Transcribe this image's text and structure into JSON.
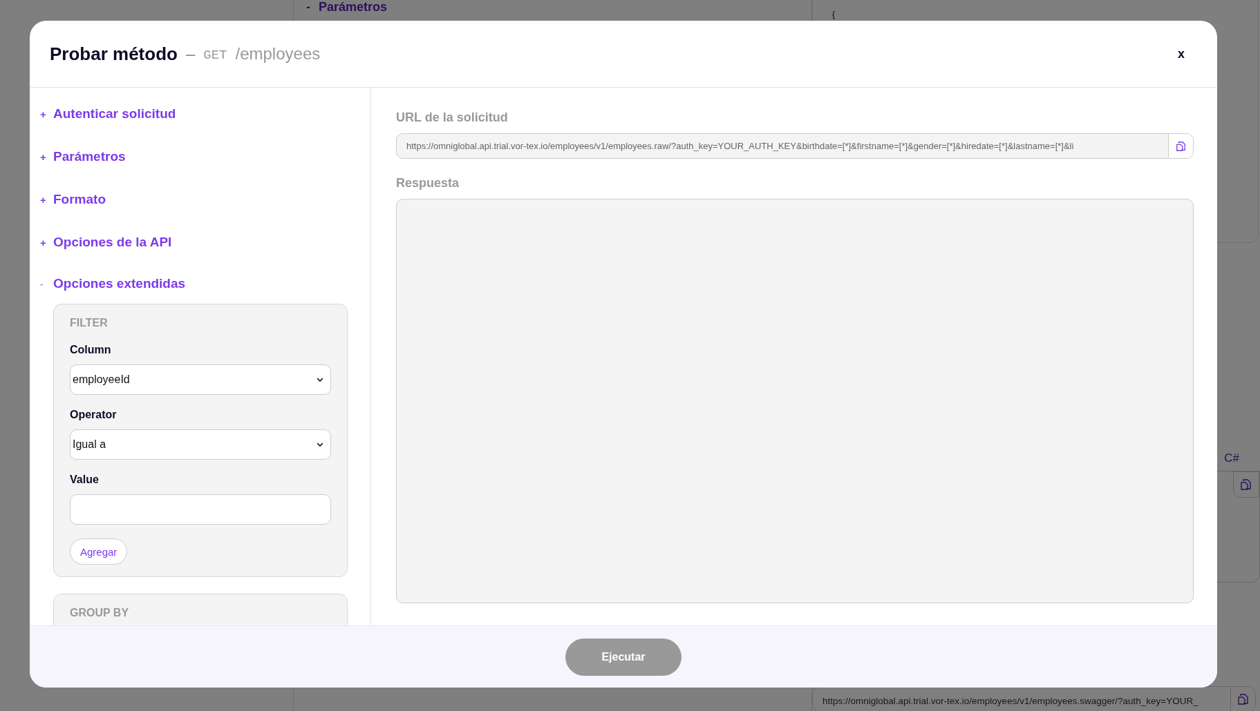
{
  "background": {
    "heading_marker": "-",
    "heading": "Parámetros",
    "code_text": "{",
    "language_tab": "C#",
    "url": "https://omniglobal.api.trial.vor-tex.io/employees/v1/employees.swagger/?auth_key=YOUR_"
  },
  "modal": {
    "title": "Probar método",
    "separator": "–",
    "method": "GET",
    "path": "/employees",
    "close": "x",
    "sections": [
      {
        "marker": "+",
        "label": "Autenticar solicitud",
        "expanded": false
      },
      {
        "marker": "+",
        "label": "Parámetros",
        "expanded": false
      },
      {
        "marker": "+",
        "label": "Formato",
        "expanded": false
      },
      {
        "marker": "+",
        "label": "Opciones de la API",
        "expanded": false
      },
      {
        "marker": "-",
        "label": "Opciones extendidas",
        "expanded": true,
        "panels": [
          {
            "title": "FILTER",
            "fields": [
              {
                "kind": "select",
                "label": "Column",
                "value": "employeeId"
              },
              {
                "kind": "select",
                "label": "Operator",
                "value": "Igual a"
              },
              {
                "kind": "input",
                "label": "Value"
              }
            ],
            "button": "Agregar"
          },
          {
            "title": "GROUP BY"
          }
        ]
      }
    ],
    "request_url": {
      "label": "URL de la solicitud",
      "value": "https://omniglobal.api.trial.vor-tex.io/employees/v1/employees.raw/?auth_key=YOUR_AUTH_KEY&birthdate=[*]&firstname=[*]&gender=[*]&hiredate=[*]&lastname=[*]&li"
    },
    "response": {
      "label": "Respuesta"
    },
    "execute_button": {
      "label": "Ejecutar",
      "disabled": true
    }
  }
}
